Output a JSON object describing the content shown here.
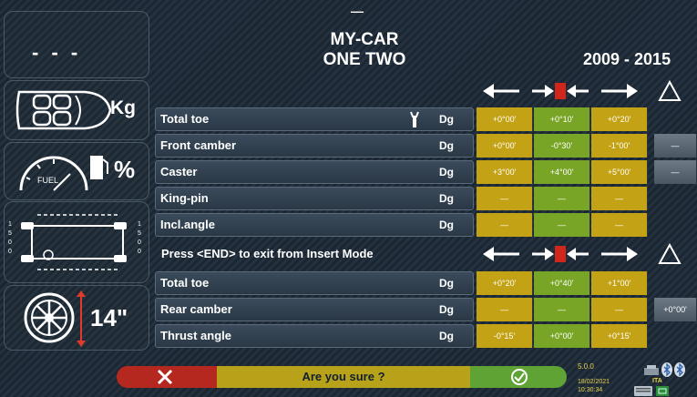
{
  "header": {
    "code": "- - -",
    "title_line1": "MY-CAR",
    "title_line2": "ONE TWO",
    "years": "2009 - 2015",
    "dash": "—"
  },
  "side": {
    "load_unit": "Kg",
    "fuel_label": "FUEL",
    "fuel_unit": "%",
    "wheel_size": "14\"",
    "axle_left": [
      "1",
      "5",
      "0",
      "0"
    ],
    "axle_right": [
      "1",
      "5",
      "0",
      "0"
    ]
  },
  "front_section": {
    "rows": [
      {
        "label": "Total toe",
        "unit": "Dg",
        "min": "+0°00'",
        "nom": "+0°10'",
        "max": "+0°20'",
        "extra": ""
      },
      {
        "label": "Front camber",
        "unit": "Dg",
        "min": "+0°00'",
        "nom": "-0°30'",
        "max": "-1°00'",
        "extra": "—"
      },
      {
        "label": "Caster",
        "unit": "Dg",
        "min": "+3°00'",
        "nom": "+4°00'",
        "max": "+5°00'",
        "extra": "—"
      },
      {
        "label": "King-pin",
        "unit": "Dg",
        "min": "—",
        "nom": "—",
        "max": "—",
        "extra": ""
      },
      {
        "label": "Incl.angle",
        "unit": "Dg",
        "min": "—",
        "nom": "—",
        "max": "—",
        "extra": ""
      }
    ]
  },
  "notice": "Press <END> to exit from Insert Mode",
  "rear_section": {
    "rows": [
      {
        "label": "Total toe",
        "unit": "Dg",
        "min": "+0°20'",
        "nom": "+0°40'",
        "max": "+1°00'",
        "extra": ""
      },
      {
        "label": "Rear camber",
        "unit": "Dg",
        "min": "—",
        "nom": "—",
        "max": "—",
        "extra": "+0°00'"
      },
      {
        "label": "Thrust angle",
        "unit": "Dg",
        "min": "-0°15'",
        "nom": "+0°00'",
        "max": "+0°15'",
        "extra": ""
      }
    ]
  },
  "footer": {
    "prompt": "Are you sure ?",
    "version": "5.0.0",
    "date": "18/02/2021",
    "time": "10:30:34",
    "language": "ITA"
  },
  "colors": {
    "min_cell": "#c4a215",
    "nom_cell": "#79a526",
    "cancel": "#b4281f",
    "confirm": "#5fa335"
  }
}
